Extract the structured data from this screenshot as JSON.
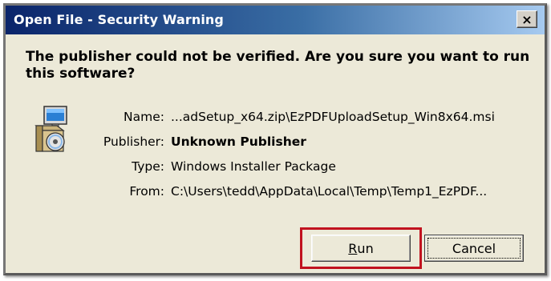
{
  "window": {
    "title": "Open File - Security Warning",
    "close_glyph": "×"
  },
  "message": "The publisher could not be verified.  Are you sure you want to run this software?",
  "icon": "windows-installer-icon",
  "details": {
    "name_label": "Name:",
    "name_value": "...adSetup_x64.zip\\EzPDFUploadSetup_Win8x64.msi",
    "publisher_label": "Publisher:",
    "publisher_value": "Unknown Publisher",
    "type_label": "Type:",
    "type_value": "Windows Installer Package",
    "from_label": "From:",
    "from_value": "C:\\Users\\tedd\\AppData\\Local\\Temp\\Temp1_EzPDF..."
  },
  "buttons": {
    "run_mnemonic": "R",
    "run_rest": "un",
    "cancel": "Cancel"
  },
  "colors": {
    "highlight": "#c1121f",
    "titlebar_start": "#0a246a",
    "titlebar_end": "#a6caf0"
  }
}
